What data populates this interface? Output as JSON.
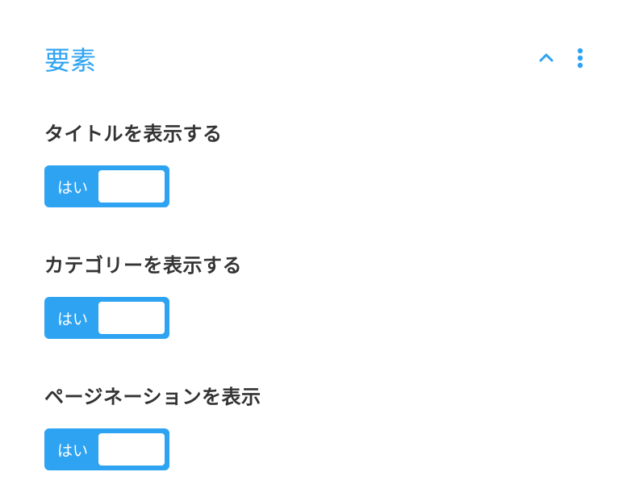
{
  "panel": {
    "title": "要素"
  },
  "settings": [
    {
      "label": "タイトルを表示する",
      "toggle_value": "はい"
    },
    {
      "label": "カテゴリーを表示する",
      "toggle_value": "はい"
    },
    {
      "label": "ページネーションを表示",
      "toggle_value": "はい"
    }
  ]
}
